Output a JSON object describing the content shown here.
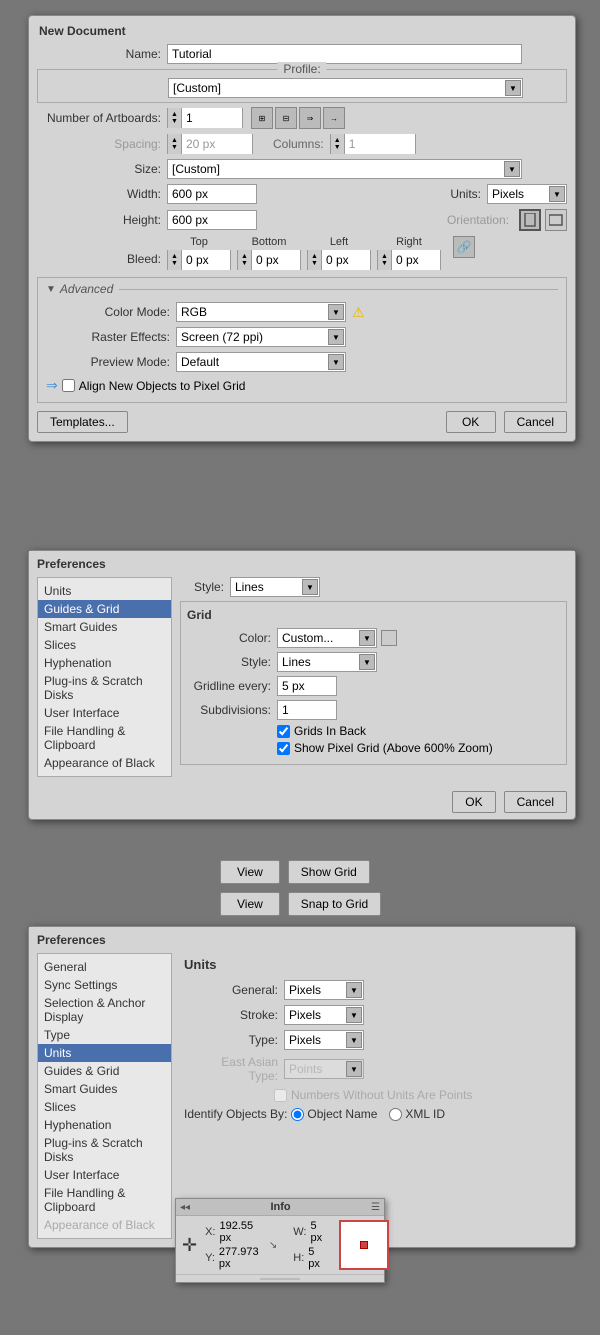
{
  "newDoc": {
    "title": "New Document",
    "nameLabel": "Name:",
    "nameValue": "Tutorial",
    "profileLabel": "Profile:",
    "profileValue": "[Custom]",
    "artboardsLabel": "Number of Artboards:",
    "artboardsValue": "1",
    "spacingLabel": "Spacing:",
    "spacingValue": "20 px",
    "columnsLabel": "Columns:",
    "columnsValue": "1",
    "sizeLabel": "Size:",
    "sizeValue": "[Custom]",
    "widthLabel": "Width:",
    "widthValue": "600 px",
    "unitsLabel": "Units:",
    "unitsValue": "Pixels",
    "heightLabel": "Height:",
    "heightValue": "600 px",
    "orientationLabel": "Orientation:",
    "bleedLabel": "Bleed:",
    "bleedTop": "0 px",
    "bleedBottom": "0 px",
    "bleedLeft": "0 px",
    "bleedRight": "0 px",
    "bleedTopLabel": "Top",
    "bleedBottomLabel": "Bottom",
    "bleedLeftLabel": "Left",
    "bleedRightLabel": "Right",
    "advancedLabel": "Advanced",
    "colorModeLabel": "Color Mode:",
    "colorModeValue": "RGB",
    "rasterLabel": "Raster Effects:",
    "rasterValue": "Screen (72 ppi)",
    "previewLabel": "Preview Mode:",
    "previewValue": "Default",
    "pixelGridLabel": "Align New Objects to Pixel Grid",
    "templatesBtn": "Templates...",
    "okBtn": "OK",
    "cancelBtn": "Cancel"
  },
  "prefsGuides": {
    "title": "Preferences",
    "guidesStyleLabel": "Style:",
    "guidesStyleValue": "Lines",
    "gridGroupTitle": "Grid",
    "gridColorLabel": "Color:",
    "gridColorValue": "Custom...",
    "gridStyleLabel": "Style:",
    "gridStyleValue": "Lines",
    "gridlineEveryLabel": "Gridline every:",
    "gridlineEveryValue": "5 px",
    "subdivisionsLabel": "Subdivisions:",
    "subdivisionsValue": "1",
    "gridsInBackLabel": "Grids In Back",
    "showPixelGridLabel": "Show Pixel Grid (Above 600% Zoom)",
    "okBtn": "OK",
    "cancelBtn": "Cancel",
    "sidebarItems": [
      "Units",
      "Guides & Grid",
      "Smart Guides",
      "Slices",
      "Hyphenation",
      "Plug-ins & Scratch Disks",
      "User Interface",
      "File Handling & Clipboard",
      "Appearance of Black"
    ],
    "activeSidebarItem": "Guides & Grid"
  },
  "viewButtons": {
    "viewBtn1": "View",
    "showGridBtn": "Show Grid",
    "viewBtn2": "View",
    "snapGridBtn": "Snap to Grid"
  },
  "prefsUnits": {
    "title": "Preferences",
    "sectionTitle": "Units",
    "generalLabel": "General:",
    "generalValue": "Pixels",
    "strokeLabel": "Stroke:",
    "strokeValue": "Pixels",
    "typeLabel": "Type:",
    "typeValue": "Pixels",
    "eastAsianLabel": "East Asian Type:",
    "eastAsianValue": "Points",
    "numbersWithoutUnitsLabel": "Numbers Without Units Are Points",
    "identifyLabel": "Identify Objects By:",
    "objectNameLabel": "Object Name",
    "xmlIdLabel": "XML ID",
    "sidebarItems": [
      "General",
      "Sync Settings",
      "Selection & Anchor Display",
      "Type",
      "Units",
      "Guides & Grid",
      "Smart Guides",
      "Slices",
      "Hyphenation",
      "Plug-ins & Scratch Disks",
      "User Interface",
      "File Handling & Clipboard",
      "Appearance of Black"
    ],
    "activeSidebarItem": "Units"
  },
  "infoPanel": {
    "title": "Info",
    "xLabel": "X:",
    "xValue": "192.55 px",
    "yLabel": "Y:",
    "yValue": "277.973 px",
    "wLabel": "W:",
    "wValue": "5 px",
    "hLabel": "H:",
    "hValue": "5 px"
  }
}
